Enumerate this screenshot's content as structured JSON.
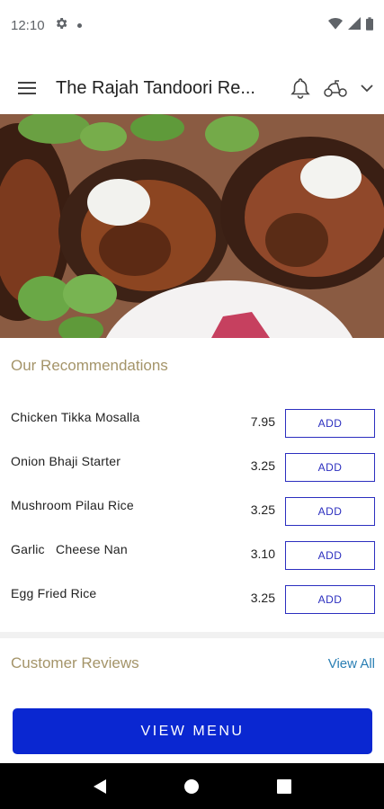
{
  "status_bar": {
    "time": "12:10",
    "icons": [
      "settings-icon",
      "wifi-icon",
      "signal-icon",
      "battery-icon"
    ]
  },
  "app_bar": {
    "title": "The Rajah Tandoori Re...",
    "icons": [
      "menu-icon",
      "bell-icon",
      "scooter-icon",
      "chevron-down-icon"
    ]
  },
  "recommendations": {
    "title": "Our Recommendations",
    "items": [
      {
        "name": "Chicken Tikka Mosalla",
        "price": "7.95",
        "button": "ADD"
      },
      {
        "name": "Onion Bhaji Starter",
        "price": "3.25",
        "button": "ADD"
      },
      {
        "name": "Mushroom Pilau Rice",
        "price": "3.25",
        "button": "ADD"
      },
      {
        "name": "Garlic   Cheese Nan",
        "price": "3.10",
        "button": "ADD"
      },
      {
        "name": "Egg Fried Rice",
        "price": "3.25",
        "button": "ADD"
      }
    ]
  },
  "reviews": {
    "title": "Customer Reviews",
    "view_all": "View All"
  },
  "view_menu_button": "VIEW MENU",
  "colors": {
    "accent_gold": "#a49469",
    "primary_blue": "#0a27d1",
    "add_button_blue": "#2c2fbf",
    "link_blue": "#2a7fb4"
  }
}
